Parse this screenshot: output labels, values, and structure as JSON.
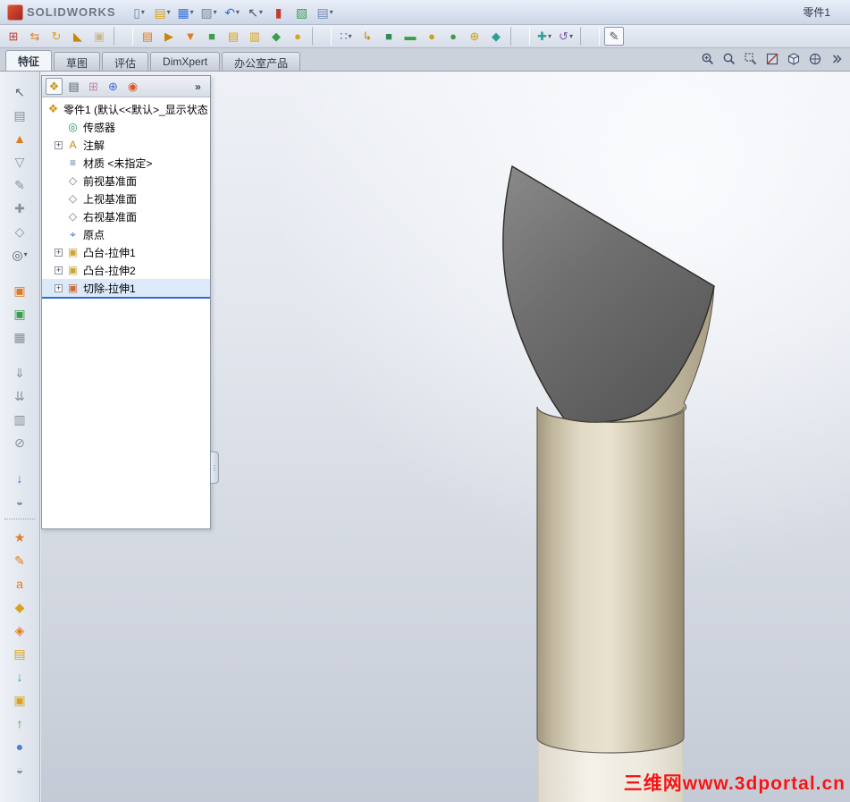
{
  "titlebar": {
    "app": "SOLIDWORKS",
    "doc": "零件1",
    "icons": [
      {
        "name": "new-document",
        "glyph": "▯",
        "color": "#6f87b0",
        "arrow": "▾"
      },
      {
        "name": "open",
        "glyph": "▤",
        "color": "#d9a21b",
        "arrow": "▾"
      },
      {
        "name": "save",
        "glyph": "▦",
        "color": "#3a6fd8",
        "arrow": "▾"
      },
      {
        "name": "print",
        "glyph": "▨",
        "color": "#7d8694",
        "arrow": "▾"
      },
      {
        "name": "undo",
        "glyph": "↶",
        "color": "#3a6fd8",
        "arrow": "▾"
      },
      {
        "name": "select",
        "glyph": "↖",
        "color": "#4a5160",
        "arrow": "▾"
      },
      {
        "name": "rebuild",
        "glyph": "▮",
        "color": "#c23b2e",
        "arrow": ""
      },
      {
        "name": "edit-appearance",
        "glyph": "▧",
        "color": "#3a9e4c",
        "arrow": ""
      },
      {
        "name": "options",
        "glyph": "▤",
        "color": "#6f87b0",
        "arrow": "▾"
      }
    ]
  },
  "toolbar2": {
    "icons": [
      {
        "glyph": "⊞",
        "color": "#c23b2e"
      },
      {
        "glyph": "⇆",
        "color": "#e07b1f"
      },
      {
        "glyph": "↻",
        "color": "#d9a21b"
      },
      {
        "glyph": "◣",
        "color": "#c8860a"
      },
      {
        "glyph": "▣",
        "color": "#c9b98a"
      },
      {
        "cls": "sep"
      },
      {
        "glyph": "▤",
        "color": "#e07b1f"
      },
      {
        "glyph": "▶",
        "color": "#c8860a"
      },
      {
        "glyph": "▼",
        "color": "#e07b1f"
      },
      {
        "glyph": "■",
        "color": "#3a9e4c"
      },
      {
        "glyph": "▤",
        "color": "#d9a21b"
      },
      {
        "glyph": "▥",
        "color": "#d9a21b"
      },
      {
        "glyph": "◆",
        "color": "#3a9e4c"
      },
      {
        "glyph": "●",
        "color": "#d9a21b"
      },
      {
        "cls": "sep"
      },
      {
        "glyph": "∷",
        "color": "#3a6fd8",
        "arrow": "▾"
      },
      {
        "glyph": "↳",
        "color": "#c8860a"
      },
      {
        "glyph": "■",
        "color": "#2e8b57"
      },
      {
        "glyph": "▬",
        "color": "#3a9e4c"
      },
      {
        "glyph": "●",
        "color": "#c8a21b"
      },
      {
        "glyph": "●",
        "color": "#3a9e4c"
      },
      {
        "glyph": "⊕",
        "color": "#c8a21b"
      },
      {
        "glyph": "◆",
        "color": "#2aa198"
      },
      {
        "cls": "sep"
      },
      {
        "glyph": "✚",
        "color": "#2aa198",
        "arrow": "▾"
      },
      {
        "glyph": "↺",
        "color": "#7b5ea7",
        "arrow": "▾"
      },
      {
        "cls": "sep"
      },
      {
        "glyph": "✎",
        "color": "#4a5160",
        "cls": "boxed"
      }
    ]
  },
  "tabs": [
    {
      "label": "特征",
      "cls": "active"
    },
    {
      "label": "草图"
    },
    {
      "label": "评估"
    },
    {
      "label": "DimXpert"
    },
    {
      "label": "办公室产品"
    }
  ],
  "left_toolbar": {
    "top": [
      {
        "glyph": "↖",
        "color": "#5a6170"
      },
      {
        "glyph": "▤",
        "color": "#8a8f98"
      },
      {
        "glyph": "▲",
        "color": "#e07b1f"
      },
      {
        "glyph": "▽",
        "color": "#8a8f98"
      },
      {
        "glyph": "✎",
        "color": "#8a8f98"
      },
      {
        "glyph": "✚",
        "color": "#8a8f98"
      },
      {
        "glyph": "◇",
        "color": "#8a8f98"
      },
      {
        "glyph": "◎",
        "color": "#5a6170",
        "arrow": "▾"
      },
      {
        "cls": "gap"
      },
      {
        "glyph": "▣",
        "color": "#e07b1f"
      },
      {
        "glyph": "▣",
        "color": "#3a9e4c"
      },
      {
        "glyph": "▦",
        "color": "#8a8f98"
      },
      {
        "cls": "gap"
      },
      {
        "glyph": "⇓",
        "color": "#8a8f98"
      },
      {
        "glyph": "⇊",
        "color": "#8a8f98"
      },
      {
        "glyph": "▥",
        "color": "#8a8f98"
      },
      {
        "glyph": "⊘",
        "color": "#8a8f98"
      },
      {
        "cls": "gap"
      },
      {
        "glyph": "↓",
        "color": "#3a6fd8"
      },
      {
        "glyph": "◒",
        "color": "#8a8f98"
      }
    ],
    "bottom": [
      {
        "glyph": "★",
        "color": "#e07b1f"
      },
      {
        "glyph": "✎",
        "color": "#e07b1f"
      },
      {
        "glyph": "a",
        "color": "#e07b1f"
      },
      {
        "glyph": "◆",
        "color": "#d9a21b"
      },
      {
        "glyph": "◈",
        "color": "#e07b1f"
      },
      {
        "glyph": "▤",
        "color": "#d9a21b"
      },
      {
        "glyph": "↓",
        "color": "#2aa198"
      },
      {
        "glyph": "▣",
        "color": "#d9a21b"
      },
      {
        "glyph": "↑",
        "color": "#3a9e4c"
      },
      {
        "glyph": "●",
        "color": "#4a7fd4"
      },
      {
        "glyph": "◒",
        "color": "#8a8f98"
      }
    ]
  },
  "tree": {
    "header_icons": [
      {
        "glyph": "❖",
        "color": "#c79a1e",
        "cls": "active"
      },
      {
        "glyph": "▤",
        "color": "#5a6170"
      },
      {
        "glyph": "⊞",
        "color": "#c77fae"
      },
      {
        "glyph": "⊕",
        "color": "#3a6fd8"
      },
      {
        "glyph": "◉",
        "color": "#e0542e"
      },
      {
        "glyph": "»",
        "color": "#33425e",
        "cls": "chev"
      }
    ],
    "root": {
      "glyph": "❖",
      "label": "零件1 (默认<<默认>_显示状态"
    },
    "items": [
      {
        "expand": "",
        "glyph": "◎",
        "color": "#2e8b57",
        "label": "传感器"
      },
      {
        "expand": "+",
        "glyph": "A",
        "color": "#c8860a",
        "label": "注解"
      },
      {
        "expand": "",
        "glyph": "≡",
        "color": "#5577aa",
        "label": "材质 <未指定>"
      },
      {
        "expand": "",
        "glyph": "◇",
        "color": "#6b7684",
        "label": "前视基准面"
      },
      {
        "expand": "",
        "glyph": "◇",
        "color": "#6b7684",
        "label": "上视基准面"
      },
      {
        "expand": "",
        "glyph": "◇",
        "color": "#6b7684",
        "label": "右视基准面"
      },
      {
        "expand": "",
        "glyph": "⌖",
        "color": "#3a6fd8",
        "label": "原点"
      },
      {
        "expand": "+",
        "glyph": "▣",
        "color": "#caa53d",
        "label": "凸台-拉伸1"
      },
      {
        "expand": "+",
        "glyph": "▣",
        "color": "#caa53d",
        "label": "凸台-拉伸2"
      },
      {
        "expand": "+",
        "glyph": "▣",
        "color": "#ca6a3d",
        "label": "切除-拉伸1",
        "cls": "selected"
      }
    ],
    "handle_glyph": "⋮"
  },
  "viewport": {
    "watermark": "三维网www.3dportal.cn"
  }
}
